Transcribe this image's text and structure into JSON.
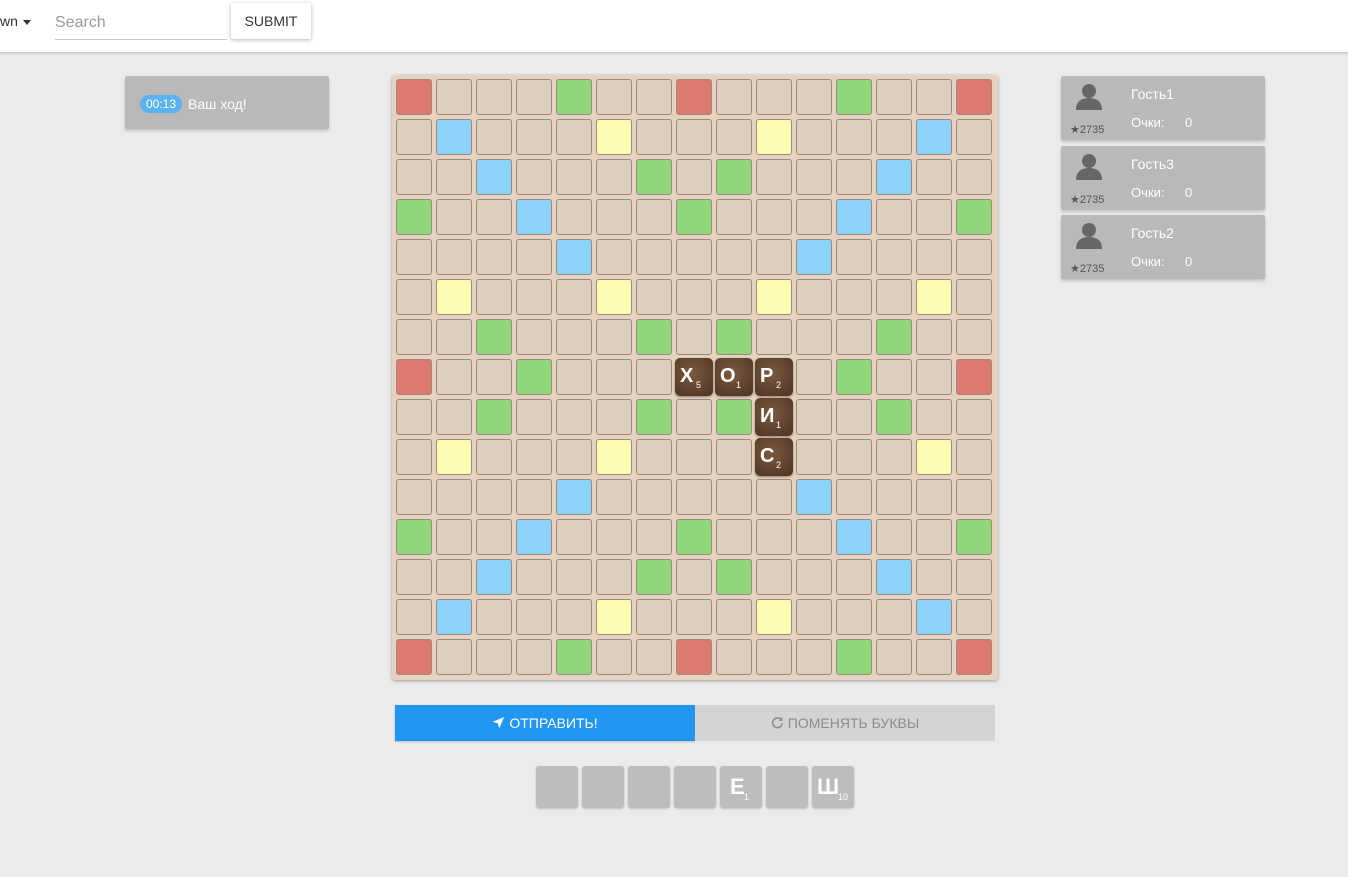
{
  "header": {
    "dropdown_label": "wn",
    "search_placeholder": "Search",
    "search_value": "",
    "submit_label": "SUBMIT"
  },
  "status": {
    "timer": "00:13",
    "text": "Ваш ход!"
  },
  "board": {
    "size": 15,
    "colors": {
      "normal": "#dccfbe",
      "red": "#dc7a70",
      "green": "#8fd67a",
      "blue": "#8dd2f8",
      "yellow": "#fefcb2"
    },
    "layout": [
      "R...G..R...G..R",
      ".B...Y...Y...B.",
      "..B...G.G...B..",
      "G..B...G...B..G",
      "....B.....B....",
      ".Y...Y...Y...Y.",
      "..G...G.G...G..",
      "R..G.......G..R",
      "..G...G.G...G..",
      ".Y...Y...Y...Y.",
      "....B.....B....",
      "G..B...G...B..G",
      "..B...G.G...B..",
      ".B...Y...Y...B.",
      "R...G..R...G..R"
    ],
    "placed_tiles": [
      {
        "row": 7,
        "col": 7,
        "letter": "Х",
        "score": "5"
      },
      {
        "row": 7,
        "col": 8,
        "letter": "О",
        "score": "1"
      },
      {
        "row": 7,
        "col": 9,
        "letter": "Р",
        "score": "2"
      },
      {
        "row": 8,
        "col": 9,
        "letter": "И",
        "score": "1"
      },
      {
        "row": 9,
        "col": 9,
        "letter": "С",
        "score": "2"
      }
    ]
  },
  "actions": {
    "send_label": "ОТПРАВИТЬ!",
    "swap_label": "ПОМЕНЯТЬ БУКВЫ"
  },
  "rack": [
    {
      "letter": "",
      "score": ""
    },
    {
      "letter": "",
      "score": ""
    },
    {
      "letter": "",
      "score": ""
    },
    {
      "letter": "",
      "score": ""
    },
    {
      "letter": "Е",
      "score": "1"
    },
    {
      "letter": "",
      "score": ""
    },
    {
      "letter": "Ш",
      "score": "10"
    }
  ],
  "players": [
    {
      "name": "Гость1",
      "rating": "★2735",
      "score_label": "Очки:",
      "score": "0"
    },
    {
      "name": "Гость3",
      "rating": "★2735",
      "score_label": "Очки:",
      "score": "0"
    },
    {
      "name": "Гость2",
      "rating": "★2735",
      "score_label": "Очки:",
      "score": "0"
    }
  ]
}
